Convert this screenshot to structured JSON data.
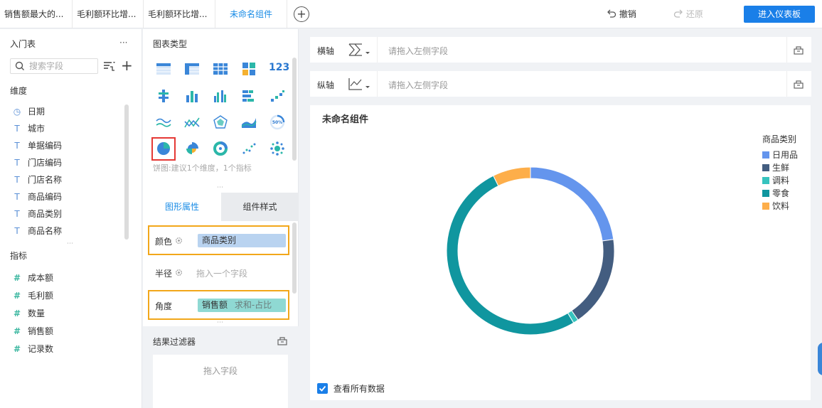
{
  "tabs": [
    {
      "label": "销售额最大的..."
    },
    {
      "label": "毛利额环比增..."
    },
    {
      "label": "毛利额环比增..."
    },
    {
      "label": "未命名组件"
    }
  ],
  "add_tab_label": "+",
  "toolbar": {
    "undo_label": "撤销",
    "redo_label": "还原",
    "enter_dashboard_label": "进入仪表板"
  },
  "left": {
    "table_name": "入门表",
    "more_label": "···",
    "search_placeholder": "搜索字段",
    "dimension_title": "维度",
    "dimensions": [
      {
        "type": "date",
        "icon_char": "◷",
        "label": "日期"
      },
      {
        "type": "text",
        "icon_char": "T",
        "label": "城市"
      },
      {
        "type": "text",
        "icon_char": "T",
        "label": "单据编码"
      },
      {
        "type": "text",
        "icon_char": "T",
        "label": "门店编码"
      },
      {
        "type": "text",
        "icon_char": "T",
        "label": "门店名称"
      },
      {
        "type": "text",
        "icon_char": "T",
        "label": "商品编码"
      },
      {
        "type": "text",
        "icon_char": "T",
        "label": "商品类别"
      },
      {
        "type": "text",
        "icon_char": "T",
        "label": "商品名称"
      }
    ],
    "measure_title": "指标",
    "measures": [
      {
        "icon_char": "#",
        "label": "成本额"
      },
      {
        "icon_char": "#",
        "label": "毛利额"
      },
      {
        "icon_char": "#",
        "label": "数量"
      },
      {
        "icon_char": "#",
        "label": "销售额"
      },
      {
        "icon_char": "#",
        "label": "记录数"
      }
    ]
  },
  "middle": {
    "chart_type_title": "图表类型",
    "chart_hint": "饼图:建议1个维度，1个指标",
    "tabs": {
      "graphic_props": "图形属性",
      "component_style": "组件样式"
    },
    "props": {
      "color_label": "颜色",
      "color_field": "商品类别",
      "radius_label": "半径",
      "radius_placeholder": "拖入一个字段",
      "angle_label": "角度",
      "angle_field": "销售额",
      "angle_agg": "求和-占比"
    },
    "filter_title": "结果过滤器",
    "filter_placeholder": "拖入字段"
  },
  "right": {
    "x_axis_label": "横轴",
    "x_axis_placeholder": "请拖入左侧字段",
    "y_axis_label": "纵轴",
    "y_axis_placeholder": "请拖入左侧字段",
    "component_title": "未命名组件",
    "view_all_label": "查看所有数据"
  },
  "chart_data": {
    "type": "pie",
    "legend_title": "商品类别",
    "legend_position": "top-right",
    "donut": true,
    "categories": [
      "日用品",
      "生鲜",
      "调料",
      "零食",
      "饮料"
    ],
    "values": [
      22.8,
      17.6,
      1.0,
      51.3,
      7.3
    ],
    "colors": [
      "#6495ed",
      "#435d80",
      "#36c3be",
      "#10969f",
      "#fdae4a"
    ]
  },
  "colors": {
    "accent": "#1a7fe8",
    "highlight_border": "#f2a71a",
    "pill_blue": "#b9d3f0",
    "pill_teal": "#8fd9d3"
  }
}
